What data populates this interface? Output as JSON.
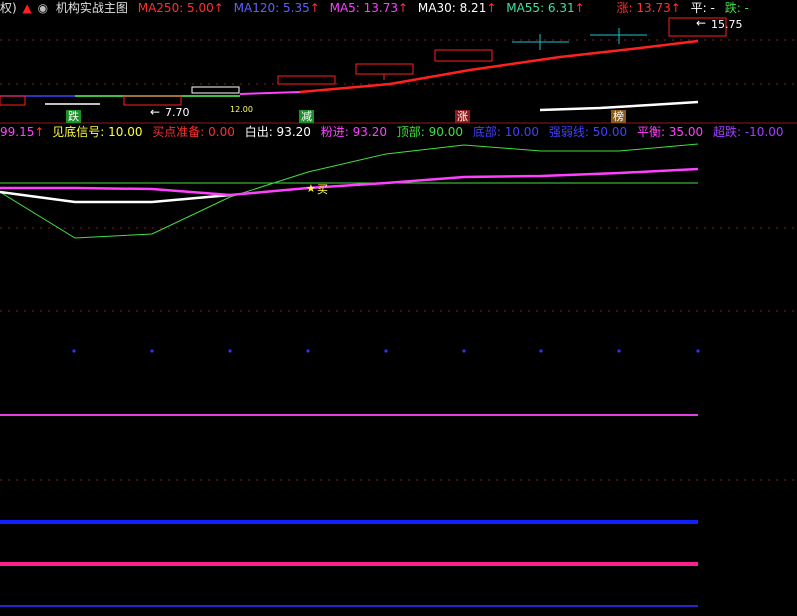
{
  "top_header": {
    "prefix": "权)",
    "title": "机构实战主图",
    "ma250": "MA250: 5.00",
    "ma120": "MA120: 5.35",
    "ma5": "MA5: 13.73",
    "ma30": "MA30: 8.21",
    "ma55": "MA55: 6.31",
    "rise": "涨: 13.73",
    "flat": "平: -",
    "fall": "跌: -",
    "up_arrow": "↑"
  },
  "price_chart": {
    "high_label": "15.75",
    "low_label": "7.70",
    "small_label": "12.00",
    "badges": [
      {
        "text": "跌",
        "color": "#1b8f2a"
      },
      {
        "text": "减",
        "color": "#1b8f2a"
      },
      {
        "text": "涨",
        "color": "#8b1a1a"
      },
      {
        "text": "榜",
        "color": "#8a5a1a"
      }
    ]
  },
  "indicator_header": {
    "value": "99.15",
    "bottom_signal": "见底信号: 10.00",
    "buy_prep": "买点准备: 0.00",
    "white_out": "白出: 93.20",
    "pink_in": "粉进: 93.20",
    "top": "顶部: 90.00",
    "bottom": "底部: 10.00",
    "strong_weak": "强弱线: 50.00",
    "balance": "平衡: 35.00",
    "oversold": "超跌: -10.00",
    "up_arrow": "↑"
  },
  "indicator_chart": {
    "buy_marker": "买"
  },
  "colors": {
    "red": "#ff2020",
    "blue": "#4040ff",
    "magenta": "#ff40ff",
    "white": "#ffffff",
    "green": "#40e040",
    "yellow": "#ffff40"
  }
}
